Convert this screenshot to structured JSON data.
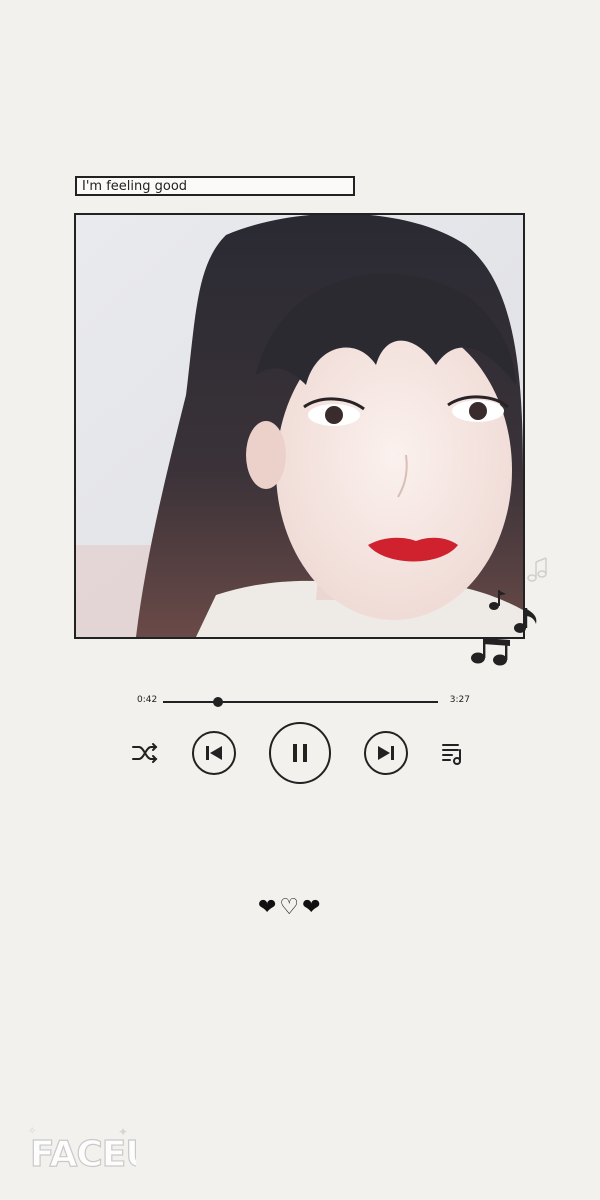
{
  "track": {
    "title": "I'm feeling good"
  },
  "player": {
    "current_time": "0:42",
    "total_time": "3:27",
    "progress": 0.2,
    "state": "playing"
  },
  "icons": {
    "shuffle": "shuffle-icon",
    "previous": "skip-previous-icon",
    "pause": "pause-icon",
    "next": "skip-next-icon",
    "playlist": "playlist-icon",
    "notes": "music-notes-icon"
  },
  "decor": {
    "hearts": "❤♡❤"
  },
  "watermark": {
    "text": "FACEU"
  },
  "colors": {
    "background": "#f3f1ed",
    "ink": "#222222",
    "lips": "#d0222e"
  }
}
